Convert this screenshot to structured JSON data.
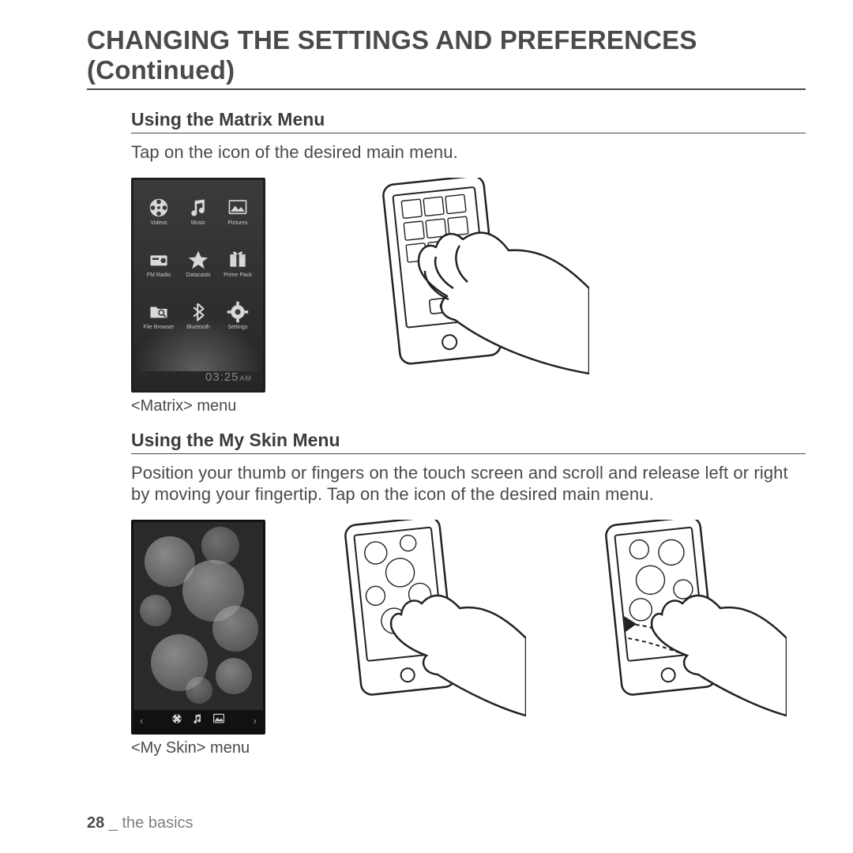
{
  "title": "CHANGING THE SETTINGS AND PREFERENCES (Continued)",
  "section1": {
    "heading": "Using the Matrix Menu",
    "body": "Tap on the icon of the desired main menu.",
    "caption": "<Matrix> menu",
    "time": "03:25",
    "ampm": "AM",
    "items": [
      {
        "label": "Videos"
      },
      {
        "label": "Music"
      },
      {
        "label": "Pictures"
      },
      {
        "label": "FM Radio"
      },
      {
        "label": "Datacasts"
      },
      {
        "label": "Prime Pack"
      },
      {
        "label": "File Browser"
      },
      {
        "label": "Bluetooth"
      },
      {
        "label": "Settings"
      }
    ]
  },
  "section2": {
    "heading": "Using the My Skin Menu",
    "body": "Position your thumb or fingers on the touch screen and scroll and release left or right by moving your fingertip. Tap on the icon of the desired main menu.",
    "caption": "<My Skin> menu"
  },
  "footer": {
    "page": "28",
    "sep": "_",
    "chapter": "the basics"
  }
}
